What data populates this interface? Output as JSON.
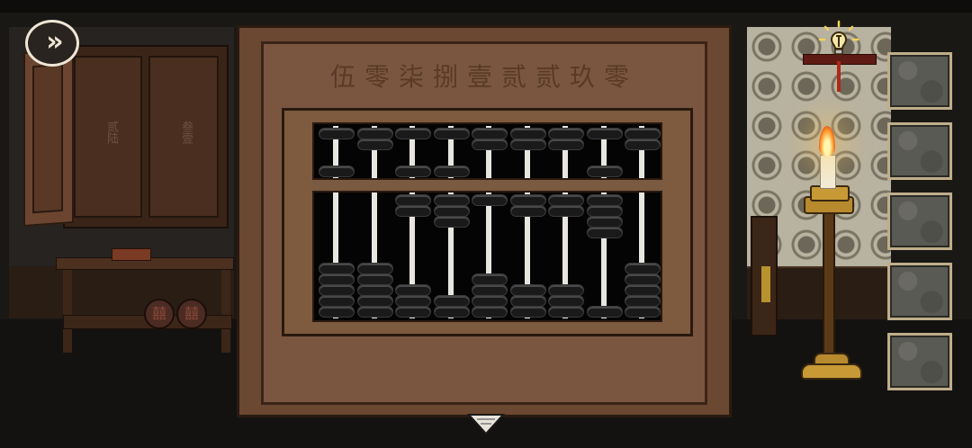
{
  "puzzle": {
    "code_text": "伍零柒捌壹贰贰玖零",
    "abacus_values": [
      5,
      0,
      7,
      8,
      1,
      2,
      2,
      9,
      0
    ]
  },
  "room": {
    "cabinet_label_left": "贰陆",
    "cabinet_label_right": "叁壹",
    "ornament_glyph": "囍"
  },
  "controls": {
    "skip_glyph": "»",
    "inventory_slots": 5
  },
  "colors": {
    "bead": "#1a1a1a",
    "rod": "#e8e6e0",
    "frame": "#7e5a3e"
  }
}
